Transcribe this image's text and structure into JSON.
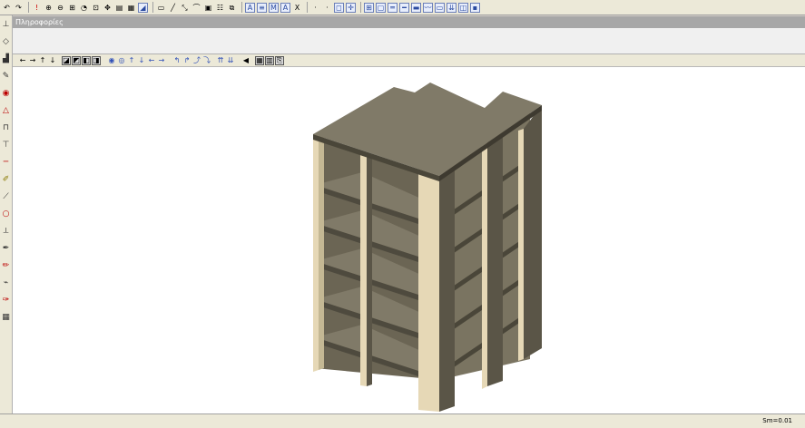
{
  "info_panel": {
    "title": "Πληροφορίες"
  },
  "status_bar": {
    "scale_text": "Sm=0.01"
  },
  "top_toolbar": {
    "letter_buttons": [
      "A",
      "A",
      "M",
      "A",
      "X"
    ]
  },
  "colors": {
    "canvas_bg": "#ffffff",
    "slab_top": "#807a68",
    "column_front": "#e6d8b6",
    "side_face": "#5a5547",
    "shadow_face": "#6b6554"
  }
}
